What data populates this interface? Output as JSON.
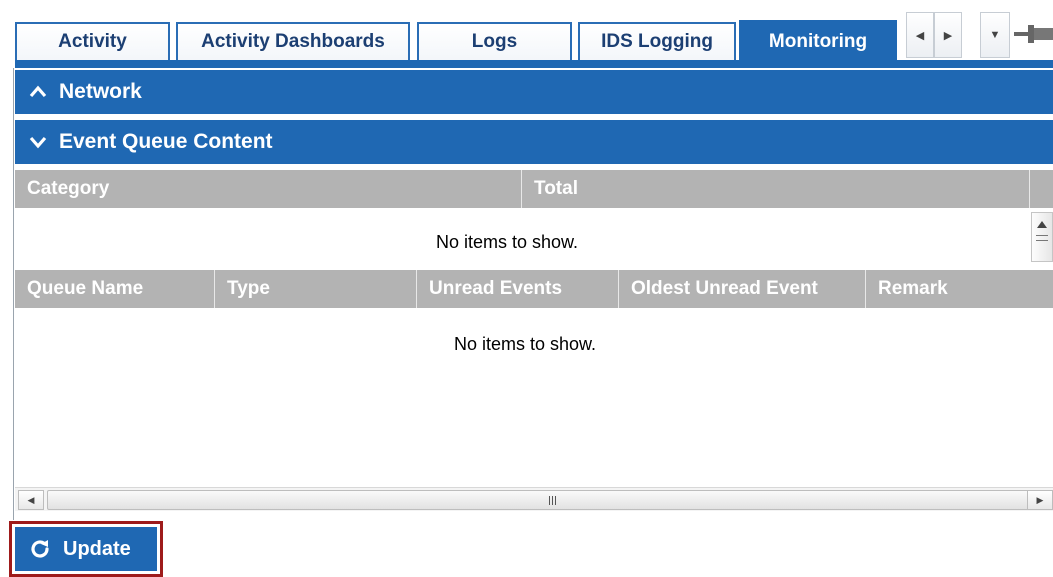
{
  "tabs": [
    {
      "label": "Activity",
      "active": false
    },
    {
      "label": "Activity Dashboards",
      "active": false
    },
    {
      "label": "Logs",
      "active": false
    },
    {
      "label": "IDS Logging",
      "active": false
    },
    {
      "label": "Monitoring",
      "active": true
    }
  ],
  "tab_controls": {
    "scroll_left_icon": "triangle-left",
    "scroll_right_icon": "triangle-right",
    "menu_icon": "triangle-down",
    "pin_icon": "pushpin"
  },
  "sections": {
    "network": {
      "title": "Network",
      "expanded": false,
      "icon": "chevron-up"
    },
    "event_queue": {
      "title": "Event Queue Content",
      "expanded": true,
      "icon": "chevron-down"
    }
  },
  "category_grid": {
    "columns": [
      "Category",
      "Total"
    ],
    "empty_text": "No items to show."
  },
  "queue_grid": {
    "columns": [
      "Queue Name",
      "Type",
      "Unread Events",
      "Oldest Unread Event",
      "Remark"
    ],
    "empty_text": "No items to show."
  },
  "update_button": {
    "label": "Update",
    "icon": "refresh"
  },
  "colors": {
    "accent": "#1f68b3",
    "grid_header": "#b3b3b3",
    "highlight_outline": "#9e1b1b"
  }
}
